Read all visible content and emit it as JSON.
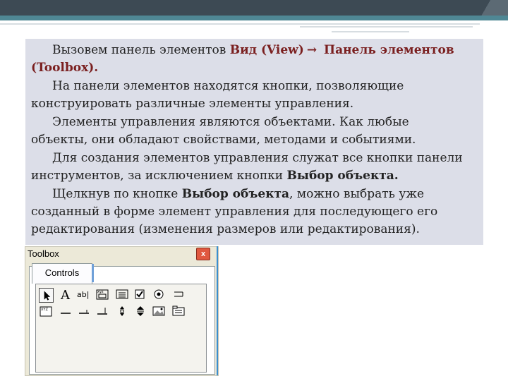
{
  "slide": {
    "p1_a": "Вызовем панель элементов ",
    "p1_menu": "Вид (View)",
    "p1_arrow": "→",
    "p1_menu2": " Панель элементов",
    "p1_b": "(Toolbox).",
    "p2_a": "На панели элементов находятся кнопки, позволяющие",
    "p2_b": "конструировать различные элементы управления.",
    "p3_a": "Элементы управления являются объектами. Как любые",
    "p3_b": "объекты, они обладают свойствами, методами и событиями.",
    "p4_a": "Для создания элементов управления служат все кнопки панели",
    "p4_b": "инструментов, за исключением кнопки ",
    "p4_bold": "Выбор объекта.",
    "p5_a": "Щелкнув по кнопке ",
    "p5_bold": "Выбор объекта",
    "p5_c": ", можно выбрать уже",
    "p5_d": "созданный в форме элемент управления для последующего его",
    "p5_e": "редактирования (изменения размеров или редактирования)."
  },
  "toolbox": {
    "title": "Toolbox",
    "close_glyph": "x",
    "tab_label": "Controls",
    "tools_row1": [
      "pointer-icon",
      "label-icon",
      "textbox-icon",
      "frame-icon",
      "commandbutton-icon",
      "checkbox-icon",
      "optionbutton-icon",
      "togglebutton-icon"
    ],
    "tools_row2": [
      "combobox-icon",
      "listbox-icon",
      "scrollbar-icon",
      "spinbutton-icon",
      "vscroll-icon",
      "spin-icon",
      "image-icon",
      "multipage-icon"
    ]
  }
}
